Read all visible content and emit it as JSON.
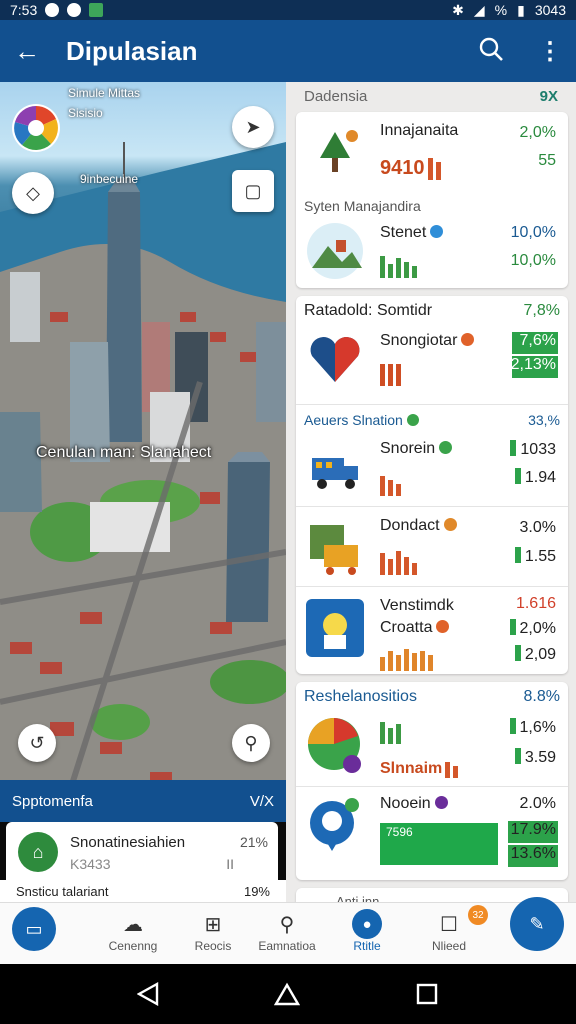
{
  "status_bar": {
    "time": "7:53",
    "right_text": "3043"
  },
  "app_bar": {
    "title": "Dipulasian"
  },
  "map": {
    "label_top_1": "Simule Mittas",
    "label_top_2": "Sisisio",
    "label_mid": "9inbecuine",
    "overlay": "Cenulan man: Slanahect"
  },
  "left_sheet": {
    "header": "Spptomenfa",
    "header_action": "V/X",
    "item_title": "Snonatinesiahien",
    "item_value": "21%",
    "item_sub": "K3433",
    "item_sub_value": "II",
    "footer_label": "Snsticu talariant",
    "footer_value": "19%"
  },
  "panel": {
    "header": "Dadensia",
    "header_action": "9X",
    "card1": {
      "rows": [
        {
          "name": "Innajanaita",
          "metric": "9410",
          "v1": "2,0%",
          "v2": "55"
        },
        {
          "name": "Stenet",
          "v1": "10,0%",
          "v2": "10,0%"
        }
      ],
      "section": "Syten Manajandira"
    },
    "card2": {
      "title": "Ratadold: Somtidr",
      "title_value": "7,8%",
      "rows": [
        {
          "name": "Snongiotar",
          "v1": "7,6%",
          "v2": "2,13%"
        }
      ],
      "section": "Aeuers Slnation",
      "section_value": "33,%",
      "rows2": [
        {
          "name": "Snorein",
          "v1": "1033",
          "v2": "1.94"
        },
        {
          "name": "Dondact",
          "v1": "3.0%",
          "v2": "1.55"
        },
        {
          "name": "Venstimdk",
          "sub": "Croatta",
          "v1": "1.616",
          "v2": "2,0%",
          "v3": "2,09"
        }
      ]
    },
    "card3": {
      "title": "Reshelanositios",
      "title_value": "8.8%",
      "rows": [
        {
          "name": "Slnnaim",
          "v1": "1,6%",
          "v2": "3.59"
        },
        {
          "name": "Nooein",
          "bar_text": "7596",
          "v1": "2.0%",
          "v2": "17.9%",
          "v3": "13.6%"
        }
      ]
    },
    "peek": "Anti inn"
  },
  "bottom_nav": {
    "items": [
      "Cenenng",
      "Reocis",
      "Eamnatioa",
      "Rtitle",
      "Nlieed"
    ],
    "badge": "32"
  },
  "colors": {
    "primary": "#12508f",
    "accent_green": "#2ca24a",
    "accent_orange": "#e0622a"
  }
}
